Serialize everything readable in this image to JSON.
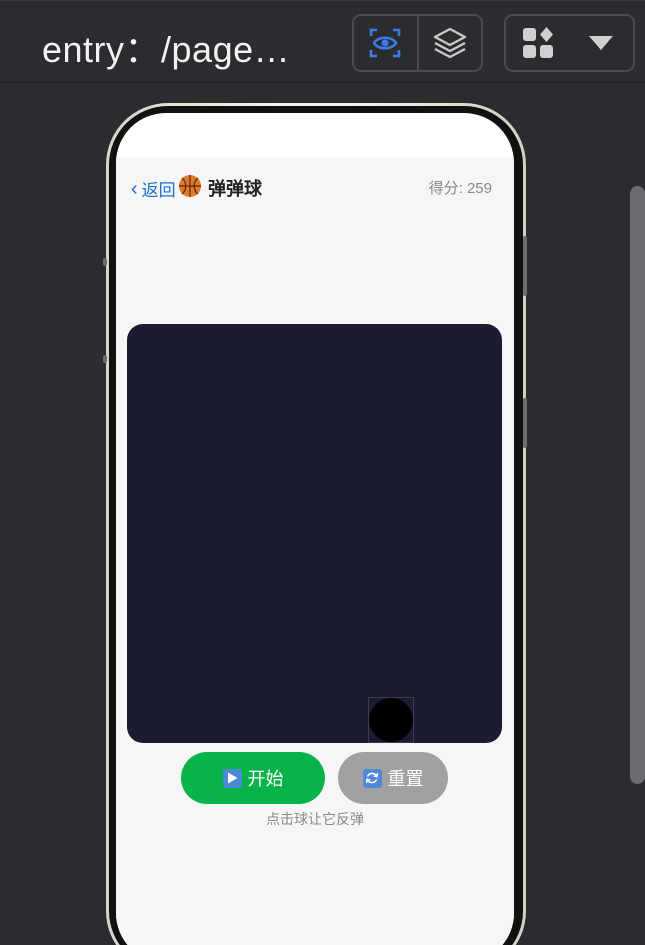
{
  "toolbar": {
    "page_title": "entry：/page…",
    "buttons": [
      {
        "icon": "eye-scan-icon",
        "active": true
      },
      {
        "icon": "layers-icon",
        "active": false
      },
      {
        "icon": "components-icon",
        "active": false
      },
      {
        "icon": "chevron-down-icon",
        "active": false
      }
    ]
  },
  "app": {
    "back_label": "返回",
    "title": "弹弹球",
    "title_icon": "basketball-icon",
    "score_text": "得分: 259",
    "start_label": "开始",
    "start_icon": "play-icon",
    "reset_label": "重置",
    "reset_icon": "refresh-icon",
    "hint": "点击球让它反弹"
  },
  "colors": {
    "accent": "#3d7bea",
    "start_button": "#0ab24a",
    "reset_button": "#a1a1a1",
    "game_background": "#1c1c31",
    "ball": "#000000",
    "back_link": "#1a6fd1"
  }
}
